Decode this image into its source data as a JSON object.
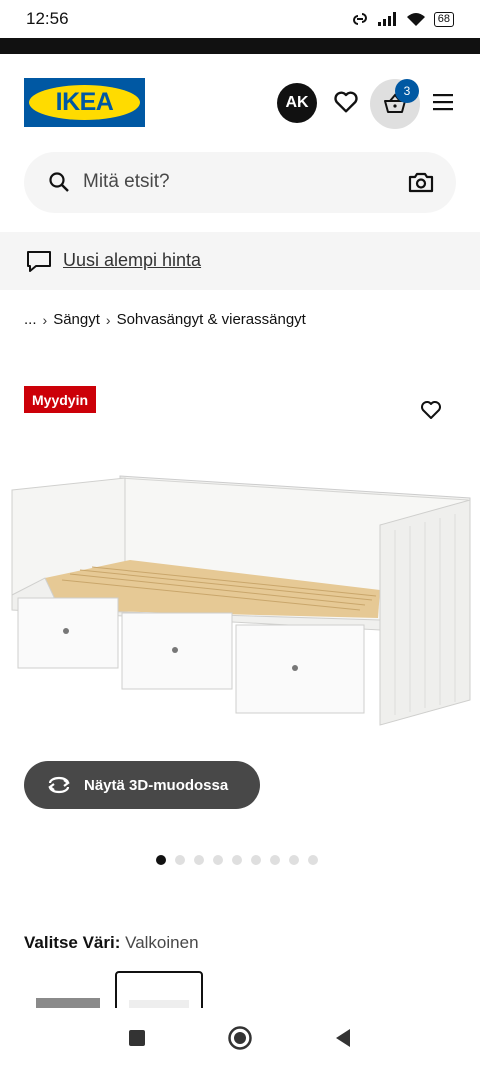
{
  "status": {
    "time": "12:56",
    "battery": "68"
  },
  "header": {
    "logo_text": "IKEA",
    "avatar_initials": "AK",
    "cart_count": "3",
    "brand_blue": "#0058a3",
    "brand_yellow": "#ffdb00"
  },
  "search": {
    "placeholder": "Mitä etsit?"
  },
  "promo": {
    "link": "Uusi alempi hinta"
  },
  "breadcrumb": {
    "items": [
      "...",
      "Sängyt",
      "Sohvasängyt & vierassängyt"
    ]
  },
  "product": {
    "badge": "Myydyin",
    "badge_color": "#cc0008",
    "view3d_label": "Näytä 3D-muodossa",
    "image_count": 9,
    "active_image": 1
  },
  "color_selector": {
    "label": "Valitse Väri:",
    "value": "Valkoinen"
  }
}
